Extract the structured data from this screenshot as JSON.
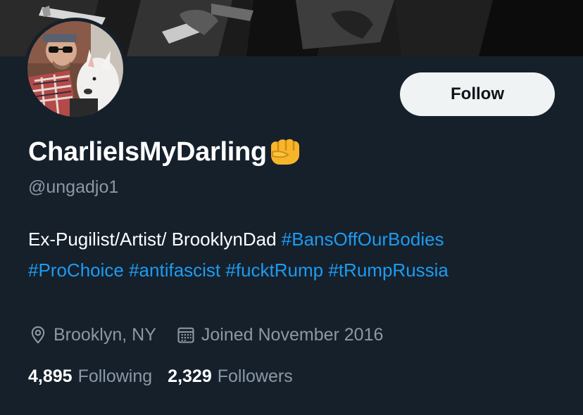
{
  "profile": {
    "display_name": "CharlieIsMyDarling",
    "name_emoji": "fist-emoji",
    "handle": "@ungadjo1",
    "follow_label": "Follow",
    "bio": {
      "text": "Ex-Pugilist/Artist/ BrooklynDad ",
      "hashtags": [
        "#BansOffOurBodies",
        "#ProChoice",
        "#antifascist",
        "#fucktRump",
        "#tRumpRussia"
      ]
    },
    "location": "Brooklyn, NY",
    "joined": "Joined November 2016",
    "following_count": "4,895",
    "following_label": "Following",
    "followers_count": "2,329",
    "followers_label": "Followers"
  },
  "icons": {
    "location": "location-pin-icon",
    "calendar": "calendar-icon"
  },
  "colors": {
    "background": "#15202b",
    "accent": "#1d9bf0",
    "secondary_text": "#8b98a5",
    "button_bg": "#eff3f4"
  }
}
